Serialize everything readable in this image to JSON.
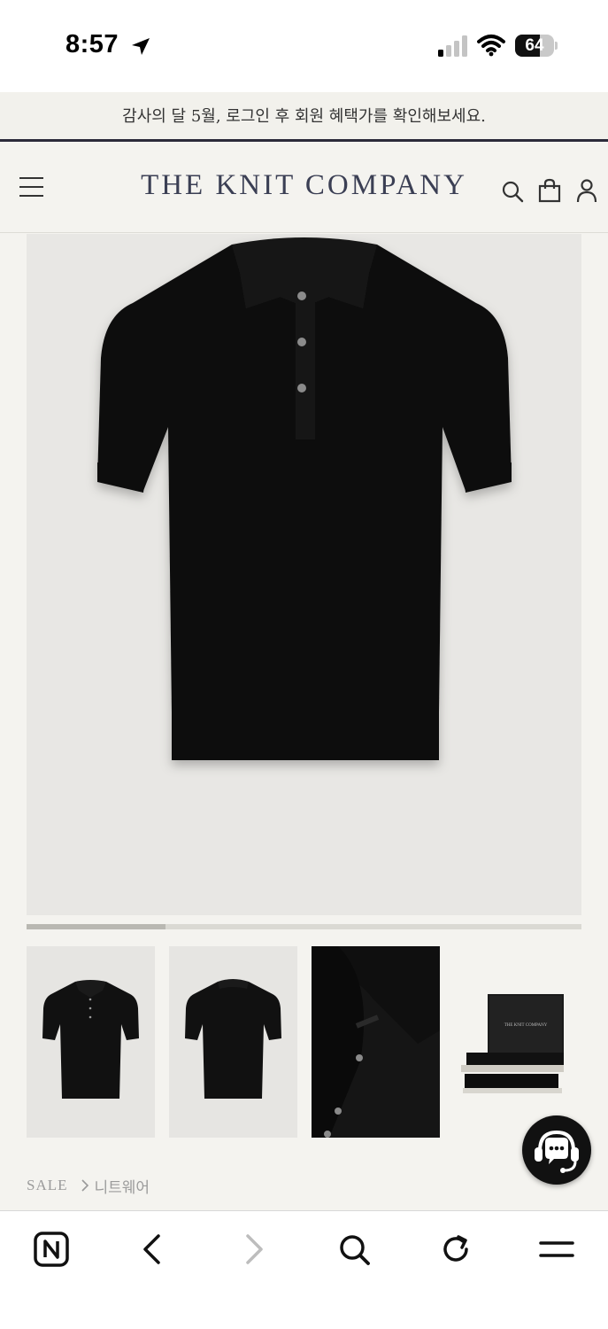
{
  "status_bar": {
    "time": "8:57",
    "battery_level": 64,
    "battery_text": "64",
    "icons": [
      "location-arrow-icon",
      "cellular-signal-icon",
      "wifi-icon",
      "battery-icon"
    ]
  },
  "promo_banner": {
    "text": "감사의 달 5월, 로그인 후 회원 혜택가를 확인해보세요."
  },
  "header": {
    "logo": "THE KNIT COMPANY",
    "icons": [
      "menu-icon",
      "search-icon",
      "shopping-bag-icon",
      "user-icon"
    ]
  },
  "gallery": {
    "main_image": "black-knit-polo-shirt",
    "thumbnails": [
      "polo-front",
      "polo-back",
      "polo-collar-detail",
      "gift-box-packaging"
    ],
    "packaging_label": "THE KNIT COMPANY",
    "progress": 0.25
  },
  "breadcrumb": {
    "root": "SALE",
    "category": "니트웨어"
  },
  "browser_bar": {
    "icons": [
      "naver-n-icon",
      "back-arrow-icon",
      "forward-arrow-icon",
      "search-icon",
      "refresh-icon",
      "menu-icon"
    ]
  },
  "colors": {
    "page_bg": "#f4f3ef",
    "logo": "#3b3f54",
    "banner_rule": "#2b2a3a",
    "garment": "#111111"
  }
}
